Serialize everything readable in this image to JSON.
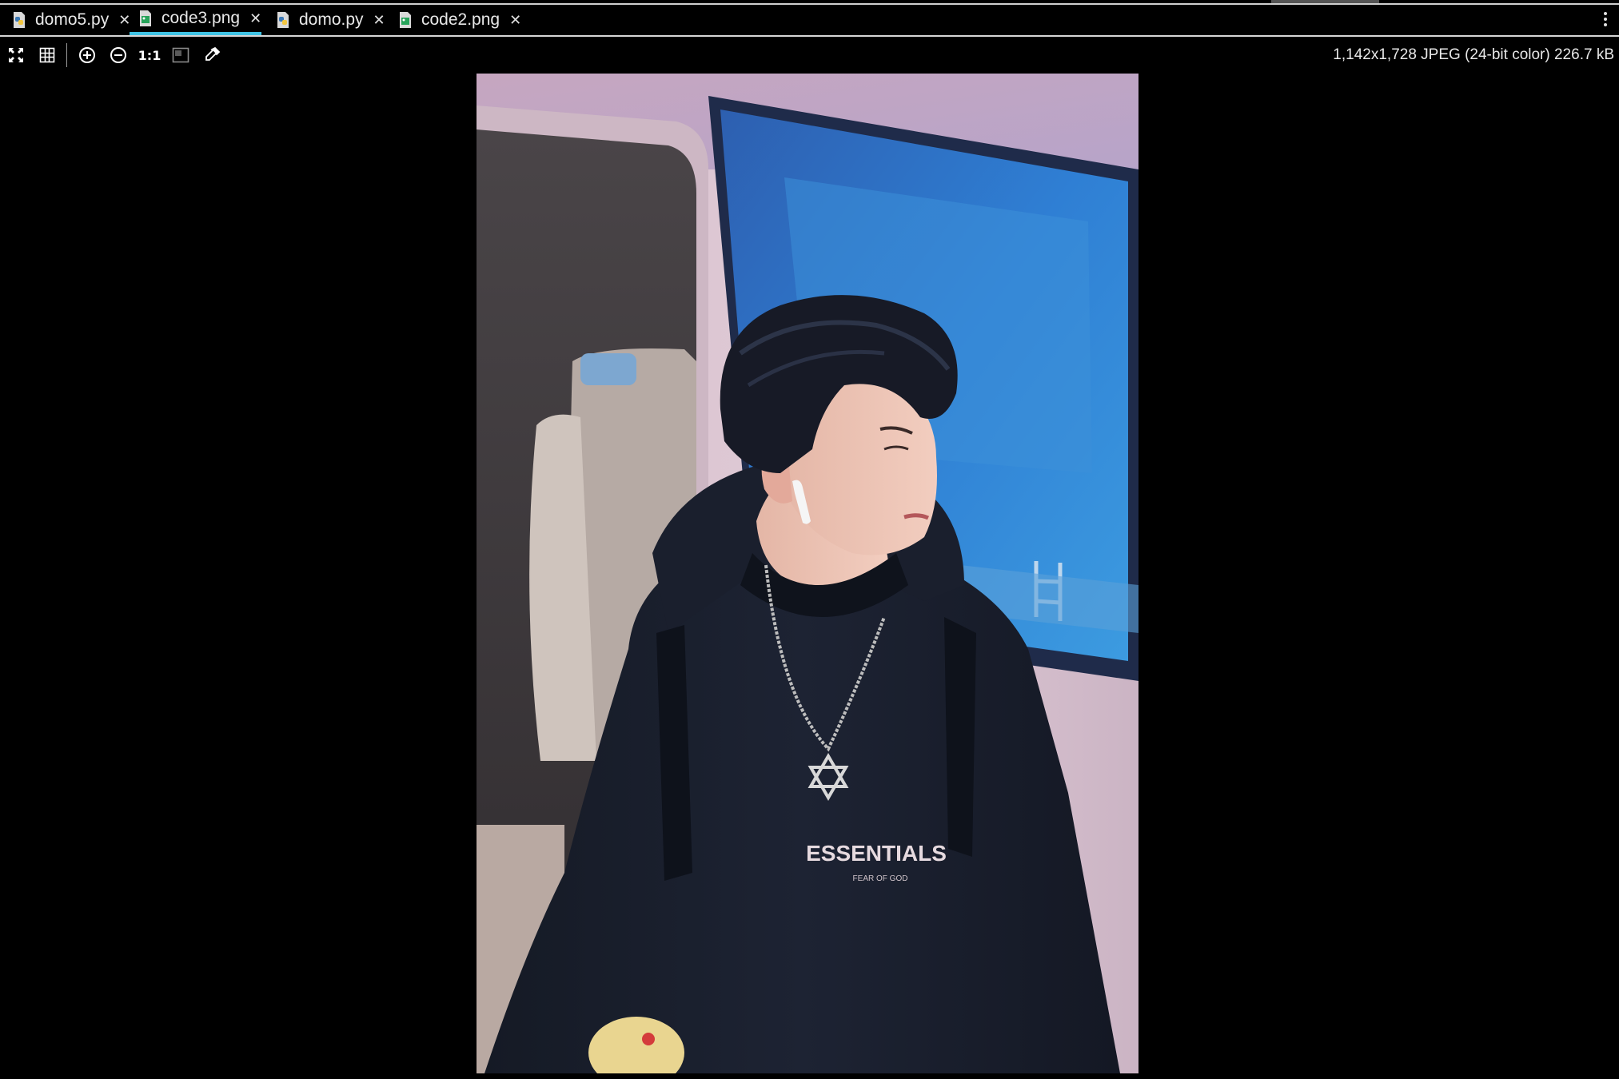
{
  "tabs": [
    {
      "label": "domo5.py",
      "icon": "python-file-icon",
      "active": false
    },
    {
      "label": "code3.png",
      "icon": "image-file-icon",
      "active": true
    },
    {
      "label": "domo.py",
      "icon": "python-file-icon",
      "active": false
    },
    {
      "label": "code2.png",
      "icon": "image-file-icon",
      "active": false
    }
  ],
  "tab_close_glyph": "✕",
  "toolbar": {
    "actual_size_label": "1:1",
    "tools": [
      "fit-to-window-icon",
      "grid-icon",
      "zoom-in-icon",
      "zoom-out-icon",
      "actual-size-icon",
      "background-icon",
      "color-picker-icon"
    ]
  },
  "image_info": "1,142x1,728 JPEG (24-bit color) 226.7 kB",
  "photo": {
    "shirt_text": "ESSENTIALS",
    "shirt_subtext": "FEAR OF GOD"
  },
  "colors": {
    "accent": "#3fc4e6",
    "background": "#000000",
    "text": "#e8e8e8"
  }
}
